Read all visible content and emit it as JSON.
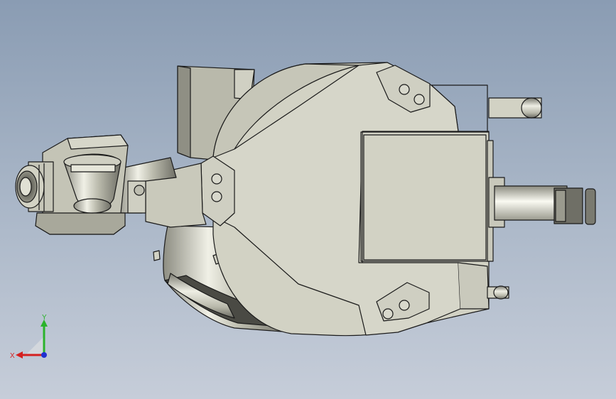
{
  "viewport": {
    "model_description_icon": "robot-arm-model",
    "background_colors": [
      "#8a9cb3",
      "#c6cdd9"
    ],
    "part_color": "#d2d2c4",
    "edge_color": "#1a1a1a"
  },
  "triad": {
    "x_label": "X",
    "y_label": "Y",
    "x_color": "#d42020",
    "y_color": "#2bb32b",
    "z_color": "#2030d0"
  }
}
